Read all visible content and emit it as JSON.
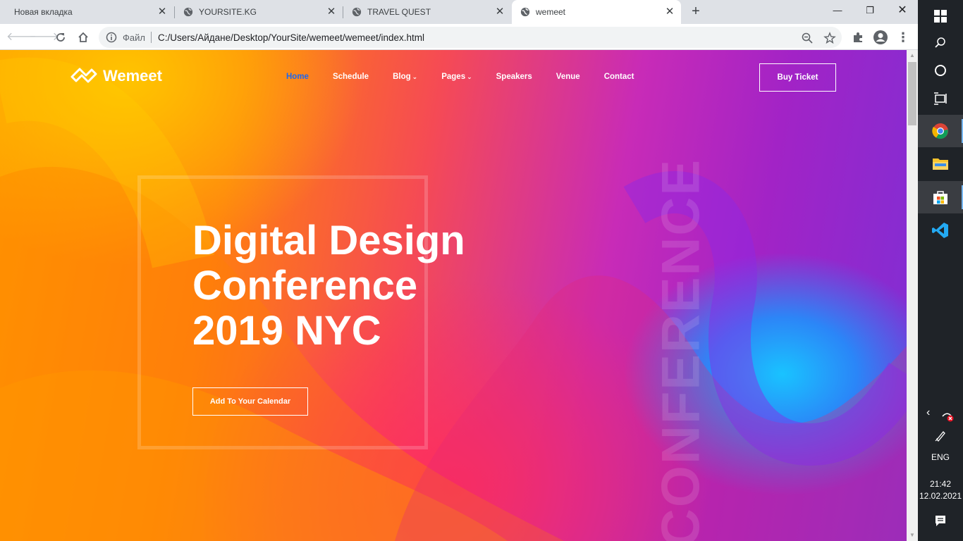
{
  "browser": {
    "tabs": [
      {
        "title": "Новая вкладка",
        "active": false
      },
      {
        "title": "YOURSITE.KG",
        "active": false
      },
      {
        "title": "TRAVEL QUEST",
        "active": false
      },
      {
        "title": "wemeet",
        "active": true
      }
    ],
    "address": {
      "scheme_label": "Файл",
      "url": "C:/Users/Айдане/Desktop/YourSite/wemeet/wemeet/index.html"
    }
  },
  "site": {
    "logo": "Wemeet",
    "nav": [
      {
        "label": "Home",
        "current": true,
        "dropdown": false
      },
      {
        "label": "Schedule",
        "current": false,
        "dropdown": false
      },
      {
        "label": "Blog",
        "current": false,
        "dropdown": true
      },
      {
        "label": "Pages",
        "current": false,
        "dropdown": true
      },
      {
        "label": "Speakers",
        "current": false,
        "dropdown": false
      },
      {
        "label": "Venue",
        "current": false,
        "dropdown": false
      },
      {
        "label": "Contact",
        "current": false,
        "dropdown": false
      }
    ],
    "buy_ticket": "Buy Ticket",
    "hero": {
      "title_lines": [
        "Digital Design",
        "Conference",
        "2019 NYC"
      ],
      "calendar_button": "Add To Your Calendar",
      "vertical_word": "CONFERENCE"
    },
    "colors": {
      "nav_active": "#1d67f0",
      "text": "#ffffff"
    }
  },
  "taskbar": {
    "language": "ENG",
    "time": "21:42",
    "date": "12.02.2021",
    "icons": [
      "windows-start-icon",
      "search-icon",
      "cortana-icon",
      "task-view-icon",
      "chrome-icon",
      "file-explorer-icon",
      "store-icon",
      "vscode-icon"
    ]
  }
}
